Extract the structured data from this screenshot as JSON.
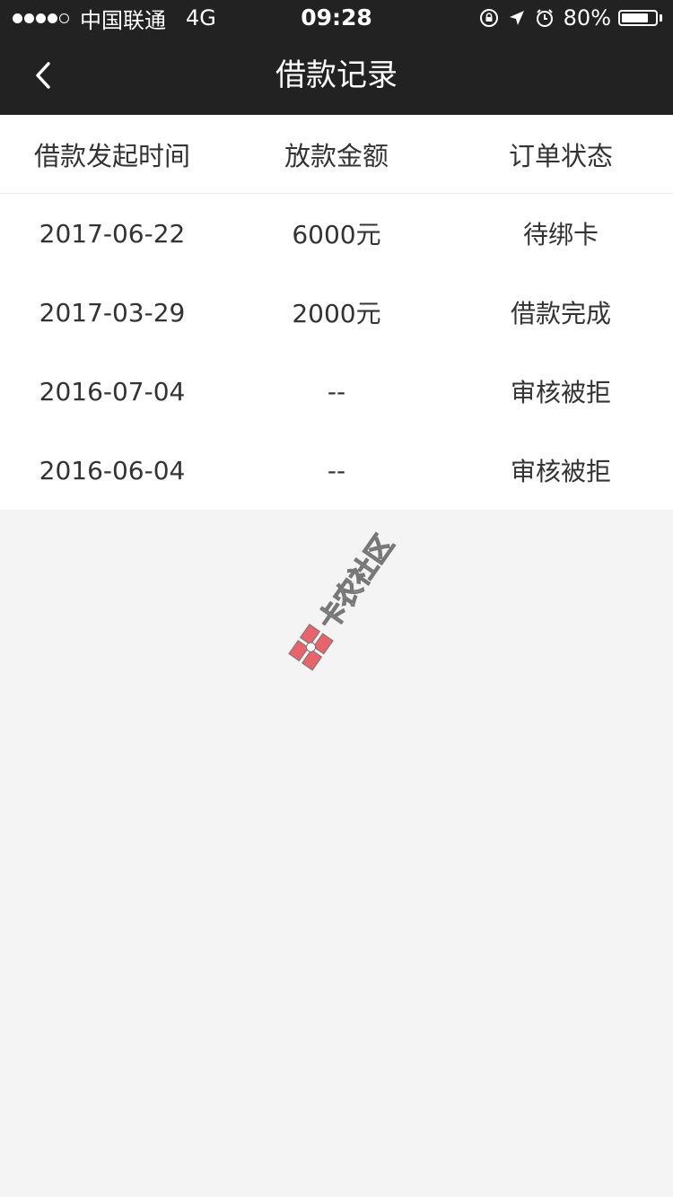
{
  "status_bar": {
    "carrier": "中国联通",
    "network": "4G",
    "time": "09:28",
    "battery_percent": "80%",
    "battery_level": 0.8,
    "signal_dots": [
      true,
      true,
      true,
      true,
      false
    ],
    "icons": [
      "rotation-lock-icon",
      "location-arrow-icon",
      "alarm-icon",
      "battery-icon"
    ]
  },
  "nav": {
    "title": "借款记录",
    "back_icon": "chevron-left-icon"
  },
  "table": {
    "headers": [
      "借款发起时间",
      "放款金额",
      "订单状态"
    ],
    "rows": [
      [
        "2017-06-22",
        "6000元",
        "待绑卡"
      ],
      [
        "2017-03-29",
        "2000元",
        "借款完成"
      ],
      [
        "2016-07-04",
        "--",
        "审核被拒"
      ],
      [
        "2016-06-04",
        "--",
        "审核被拒"
      ]
    ]
  },
  "watermark": {
    "text": "卡农社区"
  },
  "colors": {
    "bar_bg": "#222222",
    "page_bg": "#f4f4f4",
    "text": "#333333",
    "watermark_red": "#e8636a"
  }
}
